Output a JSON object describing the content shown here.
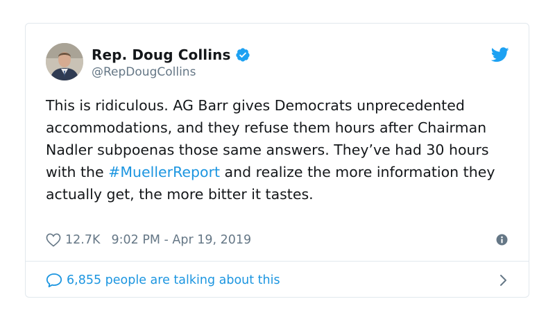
{
  "tweet": {
    "author": {
      "display_name": "Rep. Doug Collins",
      "handle": "@RepDougCollins",
      "verified": true
    },
    "text_before_hashtag": "This is ridiculous. AG Barr gives Democrats unprecedented accommodations, and they refuse them hours after Chairman Nadler subpoenas those same answers. They’ve had 30 hours with the ",
    "hashtag": "#MuellerReport",
    "text_after_hashtag": " and realize the more information they actually get, the more bitter it tastes.",
    "likes": "12.7K",
    "timestamp": "9:02 PM - Apr 19, 2019",
    "conversation": "6,855 people are talking about this"
  },
  "colors": {
    "link_blue": "#1b95e0",
    "verified_blue": "#1da1f2",
    "muted_gray": "#657786",
    "border": "#e1e8ed"
  },
  "icons": [
    "avatar-photo",
    "verified-badge-icon",
    "twitter-bird-icon",
    "heart-icon",
    "info-icon",
    "speech-bubble-icon",
    "chevron-right-icon"
  ]
}
